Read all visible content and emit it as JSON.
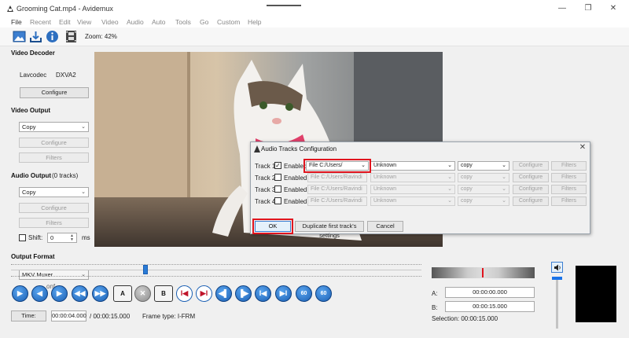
{
  "window": {
    "title": "Grooming Cat.mp4 - Avidemux",
    "minimize": "—",
    "maximize": "❐",
    "close": "✕"
  },
  "menu": [
    "File",
    "Recent",
    "Edit",
    "View",
    "Video",
    "Audio",
    "Auto",
    "Tools",
    "Go",
    "Custom",
    "Help"
  ],
  "toolbar": {
    "zoom": "Zoom: 42%"
  },
  "video_decoder": {
    "title": "Video Decoder",
    "codec_label": "Lavcodec",
    "codec_value": "DXVA2",
    "configure": "Configure"
  },
  "video_output": {
    "title": "Video Output",
    "codec": "Copy",
    "configure": "Configure",
    "filters": "Filters"
  },
  "audio_output": {
    "title": "Audio Output",
    "tracks": "(0 tracks)",
    "codec": "Copy",
    "configure": "Configure",
    "filters": "Filters",
    "shift_label": "Shift:",
    "shift_value": "0",
    "shift_unit": "ms"
  },
  "output_format": {
    "title": "Output Format",
    "muxer": "MKV Muxer",
    "under_text": "onf"
  },
  "dialog": {
    "title": "Audio Tracks Configuration",
    "close": "✕",
    "tracks": [
      {
        "label": "Track 1",
        "enabled_label": "Enabled",
        "checked": true,
        "file": "File C:/Users/",
        "lang": "Unknown",
        "codec": "copy",
        "configure": "Configure",
        "filters": "Filters"
      },
      {
        "label": "Track 2",
        "enabled_label": "Enabled",
        "checked": false,
        "file": "File C:/Users/Ravindi",
        "lang": "Unknown",
        "codec": "copy",
        "configure": "Configure",
        "filters": "Filters"
      },
      {
        "label": "Track 3",
        "enabled_label": "Enabled",
        "checked": false,
        "file": "File C:/Users/Ravindi",
        "lang": "Unknown",
        "codec": "copy",
        "configure": "Configure",
        "filters": "Filters"
      },
      {
        "label": "Track 4",
        "enabled_label": "Enabled",
        "checked": false,
        "file": "File C:/Users/Ravindi",
        "lang": "Unknown",
        "codec": "copy",
        "configure": "Configure",
        "filters": "Filters"
      }
    ],
    "ok": "OK",
    "duplicate": "Duplicate first track's settings",
    "cancel": "Cancel",
    "highlight_color": "#e0141e"
  },
  "playback": {
    "time_button": "Time:",
    "current_time": "00:00:04.000",
    "total_time": "/ 00:00:15.000",
    "frame_type": "Frame type:  I-FRM",
    "nav_labels": {
      "mark_a": "A",
      "mark_b": "B",
      "jump_60_back": "60",
      "jump_60_fwd": "60"
    }
  },
  "selection": {
    "a_label": "A:",
    "a_value": "00:00:00.000",
    "b_label": "B:",
    "b_value": "00:00:15.000",
    "selection_text": "Selection: 00:00:15.000"
  },
  "colors": {
    "accent_blue": "#1a5fb3",
    "marker_red": "#e0141e"
  }
}
